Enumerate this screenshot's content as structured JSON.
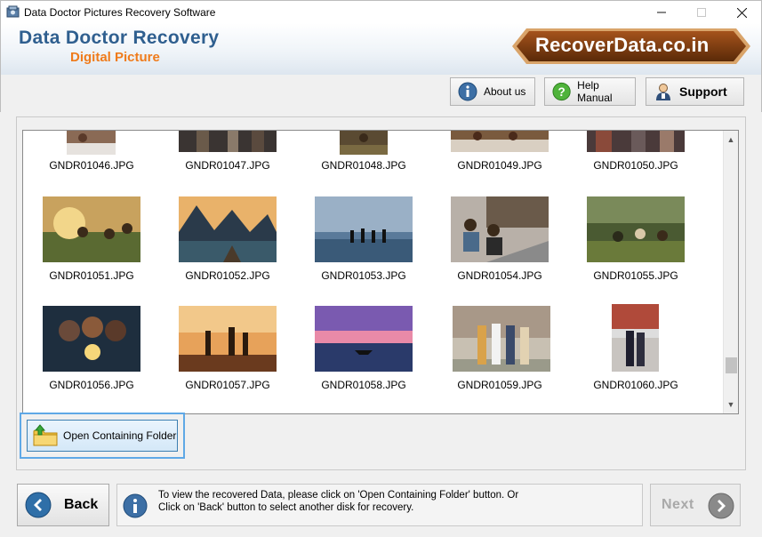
{
  "window": {
    "title": "Data Doctor Pictures Recovery Software",
    "minimize_icon": "minimize-icon",
    "maximize_icon": "maximize-icon",
    "close_icon": "close-icon"
  },
  "banner": {
    "brand": "Data Doctor Recovery",
    "subtitle": "Digital Picture",
    "logo_text": "RecoverData.co.in",
    "brand_color": "#2f5f8f",
    "subtitle_color": "#ef7b1b",
    "logo_color": "#7a3c12"
  },
  "toolbar": {
    "about_label": "About us",
    "help_label": "Help Manual",
    "support_label": "Support"
  },
  "gallery": {
    "rows": [
      [
        "GNDR01046.JPG",
        "GNDR01047.JPG",
        "GNDR01048.JPG",
        "GNDR01049.JPG",
        "GNDR01050.JPG"
      ],
      [
        "GNDR01051.JPG",
        "GNDR01052.JPG",
        "GNDR01053.JPG",
        "GNDR01054.JPG",
        "GNDR01055.JPG"
      ],
      [
        "GNDR01056.JPG",
        "GNDR01057.JPG",
        "GNDR01058.JPG",
        "GNDR01059.JPG",
        "GNDR01060.JPG"
      ]
    ]
  },
  "actions": {
    "open_folder_label": "Open Containing Folder",
    "back_label": "Back",
    "next_label": "Next",
    "info_message_line1": "To view the recovered Data, please click on 'Open Containing Folder' button. Or",
    "info_message_line2": "Click on 'Back' button to select another disk for recovery."
  }
}
